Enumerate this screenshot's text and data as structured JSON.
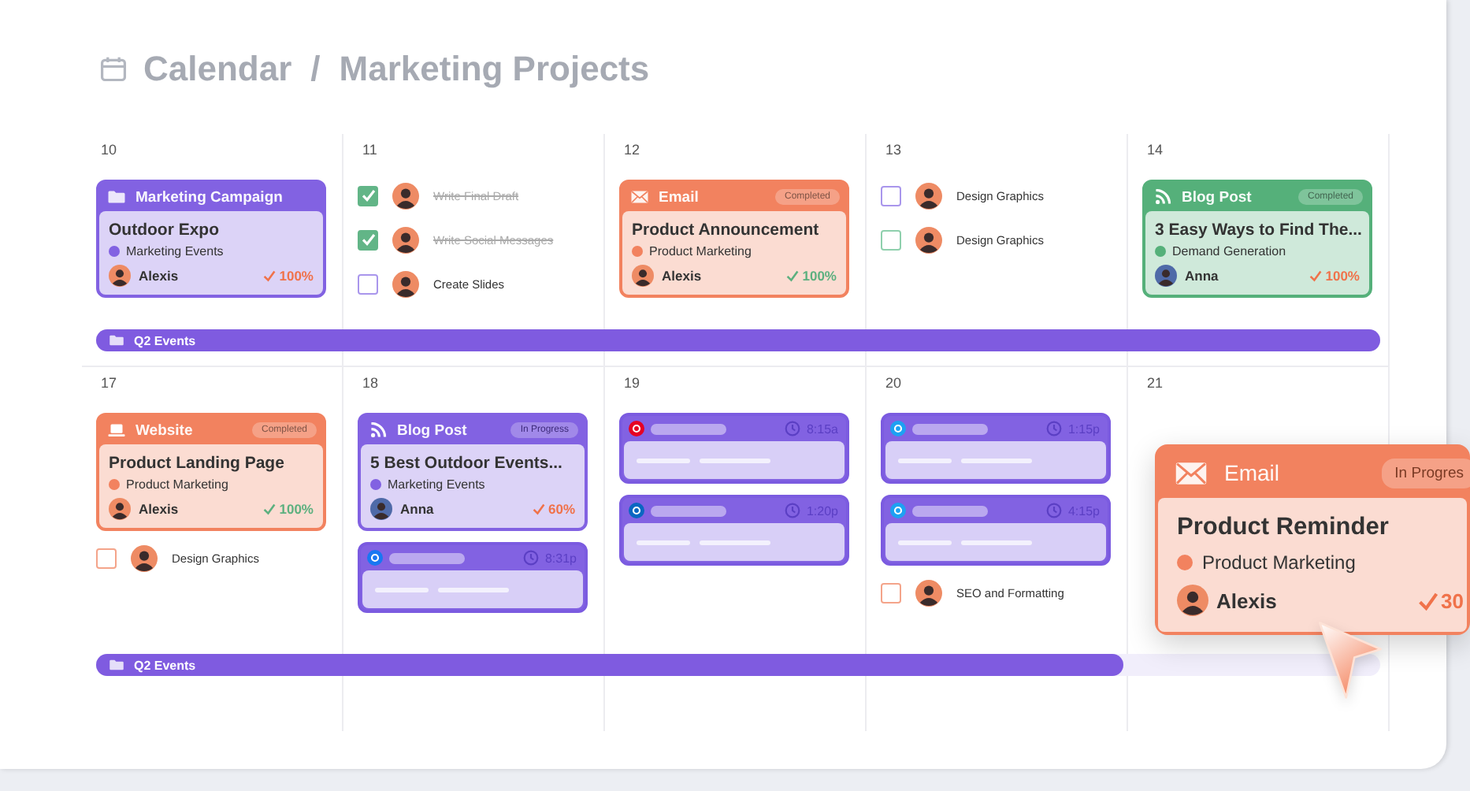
{
  "title": {
    "section": "Calendar",
    "separator": "/",
    "page": "Marketing Projects"
  },
  "weeks": [
    {
      "days": [
        {
          "date": "10",
          "items": [
            {
              "kind": "campaign",
              "color": "#8262e2",
              "type": "Marketing Campaign",
              "title": "Outdoor Expo",
              "category": "Marketing Events",
              "person": "Alexis",
              "progress": "100%"
            }
          ]
        },
        {
          "date": "11",
          "items": [
            {
              "kind": "task",
              "color": "#62b587",
              "checked": true,
              "label": "Write Final Draft"
            },
            {
              "kind": "task",
              "color": "#62b587",
              "checked": true,
              "label": "Write Social Messages"
            },
            {
              "kind": "task",
              "color": "#a996ec",
              "checked": false,
              "label": "Create Slides"
            }
          ]
        },
        {
          "date": "12",
          "items": [
            {
              "kind": "email",
              "color": "#f2825f",
              "type": "Email",
              "status": "Completed",
              "title": "Product Announcement",
              "category": "Product Marketing",
              "person": "Alexis",
              "progress": "100%"
            }
          ]
        },
        {
          "date": "13",
          "items": [
            {
              "kind": "task",
              "color": "#a996ec",
              "checked": false,
              "label": "Design Graphics"
            },
            {
              "kind": "task",
              "color": "#8fd0ad",
              "checked": false,
              "label": "Design Graphics"
            }
          ]
        },
        {
          "date": "14",
          "items": [
            {
              "kind": "blog",
              "color": "#55b07a",
              "type": "Blog Post",
              "status": "Completed",
              "title": "3 Easy Ways to Find The...",
              "category": "Demand Generation",
              "person": "Anna",
              "progress": "100%"
            }
          ]
        }
      ],
      "bar": {
        "label": "Q2 Events",
        "level": 1
      }
    },
    {
      "days": [
        {
          "date": "17",
          "items": [
            {
              "kind": "website",
              "color": "#f2825f",
              "type": "Website",
              "status": "Completed",
              "title": "Product Landing Page",
              "category": "Product Marketing",
              "person": "Alexis",
              "progress": "100%"
            },
            {
              "kind": "task",
              "color": "#f4a48a",
              "checked": false,
              "label": "Design Graphics"
            }
          ]
        },
        {
          "date": "18",
          "items": [
            {
              "kind": "blog",
              "color": "#8262e2",
              "type": "Blog Post",
              "status": "In Progress",
              "title": "5 Best Outdoor Events...",
              "category": "Marketing Events",
              "person": "Anna",
              "progress": "60%"
            },
            {
              "kind": "social",
              "color": "#1877f2",
              "time": "8:31p"
            }
          ]
        },
        {
          "date": "19",
          "items": [
            {
              "kind": "social",
              "color": "#e60023",
              "time": "8:15a"
            },
            {
              "kind": "social",
              "color": "#0a66c2",
              "time": "1:20p"
            }
          ]
        },
        {
          "date": "20",
          "items": [
            {
              "kind": "social",
              "color": "#1da1f2",
              "time": "1:15p"
            },
            {
              "kind": "social",
              "color": "#1da1f2",
              "time": "4:15p"
            },
            {
              "kind": "task",
              "color": "#f4a48a",
              "checked": false,
              "label": "SEO and Formatting"
            }
          ]
        },
        {
          "date": "21",
          "items": [
            {
              "kind": "email",
              "featured": true,
              "color": "#f2825f",
              "type": "Email",
              "status": "In Progres",
              "title": "Product Reminder",
              "category": "Product Marketing",
              "person": "Alexis",
              "progress": "30"
            }
          ]
        }
      ],
      "bar": {
        "label": "Q2 Events",
        "level": 0.8
      }
    }
  ]
}
